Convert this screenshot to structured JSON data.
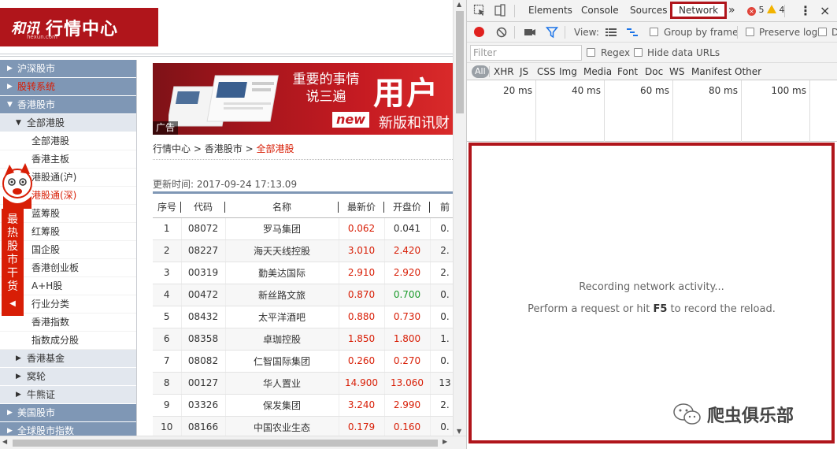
{
  "webpage": {
    "logo": {
      "brand": "和讯",
      "brand_sub": "hexun.com",
      "title": "行情中心"
    },
    "sidebar": {
      "items": [
        {
          "label": "沪深股市",
          "level": 1
        },
        {
          "label": "股转系统",
          "level": 1
        },
        {
          "label": "香港股市",
          "level": 1
        },
        {
          "label": "全部港股",
          "level": 2
        },
        {
          "label": "全部港股",
          "level": 3
        },
        {
          "label": "香港主板",
          "level": 3
        },
        {
          "label": "港股通(沪)",
          "level": 3
        },
        {
          "label": "港股通(深)",
          "level": 3
        },
        {
          "label": "蓝筹股",
          "level": 3
        },
        {
          "label": "红筹股",
          "level": 3
        },
        {
          "label": "国企股",
          "level": 3
        },
        {
          "label": "香港创业板",
          "level": 3
        },
        {
          "label": "A+H股",
          "level": 3
        },
        {
          "label": "行业分类",
          "level": 3
        },
        {
          "label": "香港指数",
          "level": 3
        },
        {
          "label": "指数成分股",
          "level": 3
        },
        {
          "label": "香港基金",
          "level": 2
        },
        {
          "label": "窝轮",
          "level": 2
        },
        {
          "label": "牛熊证",
          "level": 2
        },
        {
          "label": "美国股市",
          "level": 1
        },
        {
          "label": "全球股市指数",
          "level": 1
        }
      ]
    },
    "mascot": {
      "text": "最热股市干货"
    },
    "banner": {
      "tagline": "重要的事情说三遍",
      "big": "用户",
      "new_tag": "new",
      "new_text": "新版和讯财",
      "ad_label": "广告"
    },
    "breadcrumb": {
      "root": "行情中心",
      "sep": ">",
      "section": "香港股市",
      "current": "全部港股"
    },
    "update_time": "更新时间: 2017-09-24 17:13.09",
    "table": {
      "headers": [
        "序号",
        "代码",
        "名称",
        "最新价",
        "开盘价",
        "前"
      ],
      "rows": [
        [
          "1",
          "08072",
          "罗马集团",
          "0.062",
          "0.041",
          "0."
        ],
        [
          "2",
          "08227",
          "海天天线控股",
          "3.010",
          "2.420",
          "2."
        ],
        [
          "3",
          "00319",
          "勤美达国际",
          "2.910",
          "2.920",
          "2."
        ],
        [
          "4",
          "00472",
          "新丝路文旅",
          "0.870",
          "0.700",
          "0."
        ],
        [
          "5",
          "08432",
          "太平洋酒吧",
          "0.880",
          "0.730",
          "0."
        ],
        [
          "6",
          "08358",
          "卓珈控股",
          "1.850",
          "1.800",
          "1."
        ],
        [
          "7",
          "08082",
          "仁智国际集团",
          "0.260",
          "0.270",
          "0."
        ],
        [
          "8",
          "00127",
          "华人置业",
          "14.900",
          "13.060",
          "13"
        ],
        [
          "9",
          "03326",
          "保发集团",
          "3.240",
          "2.990",
          "2."
        ],
        [
          "10",
          "08166",
          "中国农业生态",
          "0.179",
          "0.160",
          "0."
        ]
      ],
      "price_colors": [
        "up",
        "up",
        "up",
        "up",
        "up",
        "up",
        "up",
        "up",
        "up",
        "up"
      ],
      "open_colors": [
        "flat",
        "up",
        "up",
        "down",
        "up",
        "up",
        "up",
        "up",
        "up",
        "up"
      ]
    }
  },
  "devtools": {
    "tabs": [
      "Elements",
      "Console",
      "Sources",
      "Network"
    ],
    "active_tab": "Network",
    "more": "»",
    "errors": "5",
    "warnings": "4",
    "menu": "⋮",
    "close": "×",
    "toolbar": {
      "view_label": "View:",
      "group_by_frame": "Group by frame",
      "preserve_log": "Preserve log",
      "disable_cache_partial": "D"
    },
    "filter": {
      "placeholder": "Filter",
      "regex": "Regex",
      "hide_data_urls": "Hide data URLs"
    },
    "types": [
      "All",
      "XHR",
      "JS",
      "CSS",
      "Img",
      "Media",
      "Font",
      "Doc",
      "WS",
      "Manifest",
      "Other"
    ],
    "timeline_ticks": [
      "20 ms",
      "40 ms",
      "60 ms",
      "80 ms",
      "100 ms"
    ],
    "panel": {
      "line1": "Recording network activity...",
      "line2_pre": "Perform a request or hit ",
      "line2_key": "F5",
      "line2_post": " to record the reload."
    },
    "watermark": "爬虫俱乐部"
  },
  "colors": {
    "brand_red": "#b0151b",
    "sidebar_blue": "#7f97b5",
    "price_up": "#d81e06",
    "price_down": "#1a9a2a"
  }
}
